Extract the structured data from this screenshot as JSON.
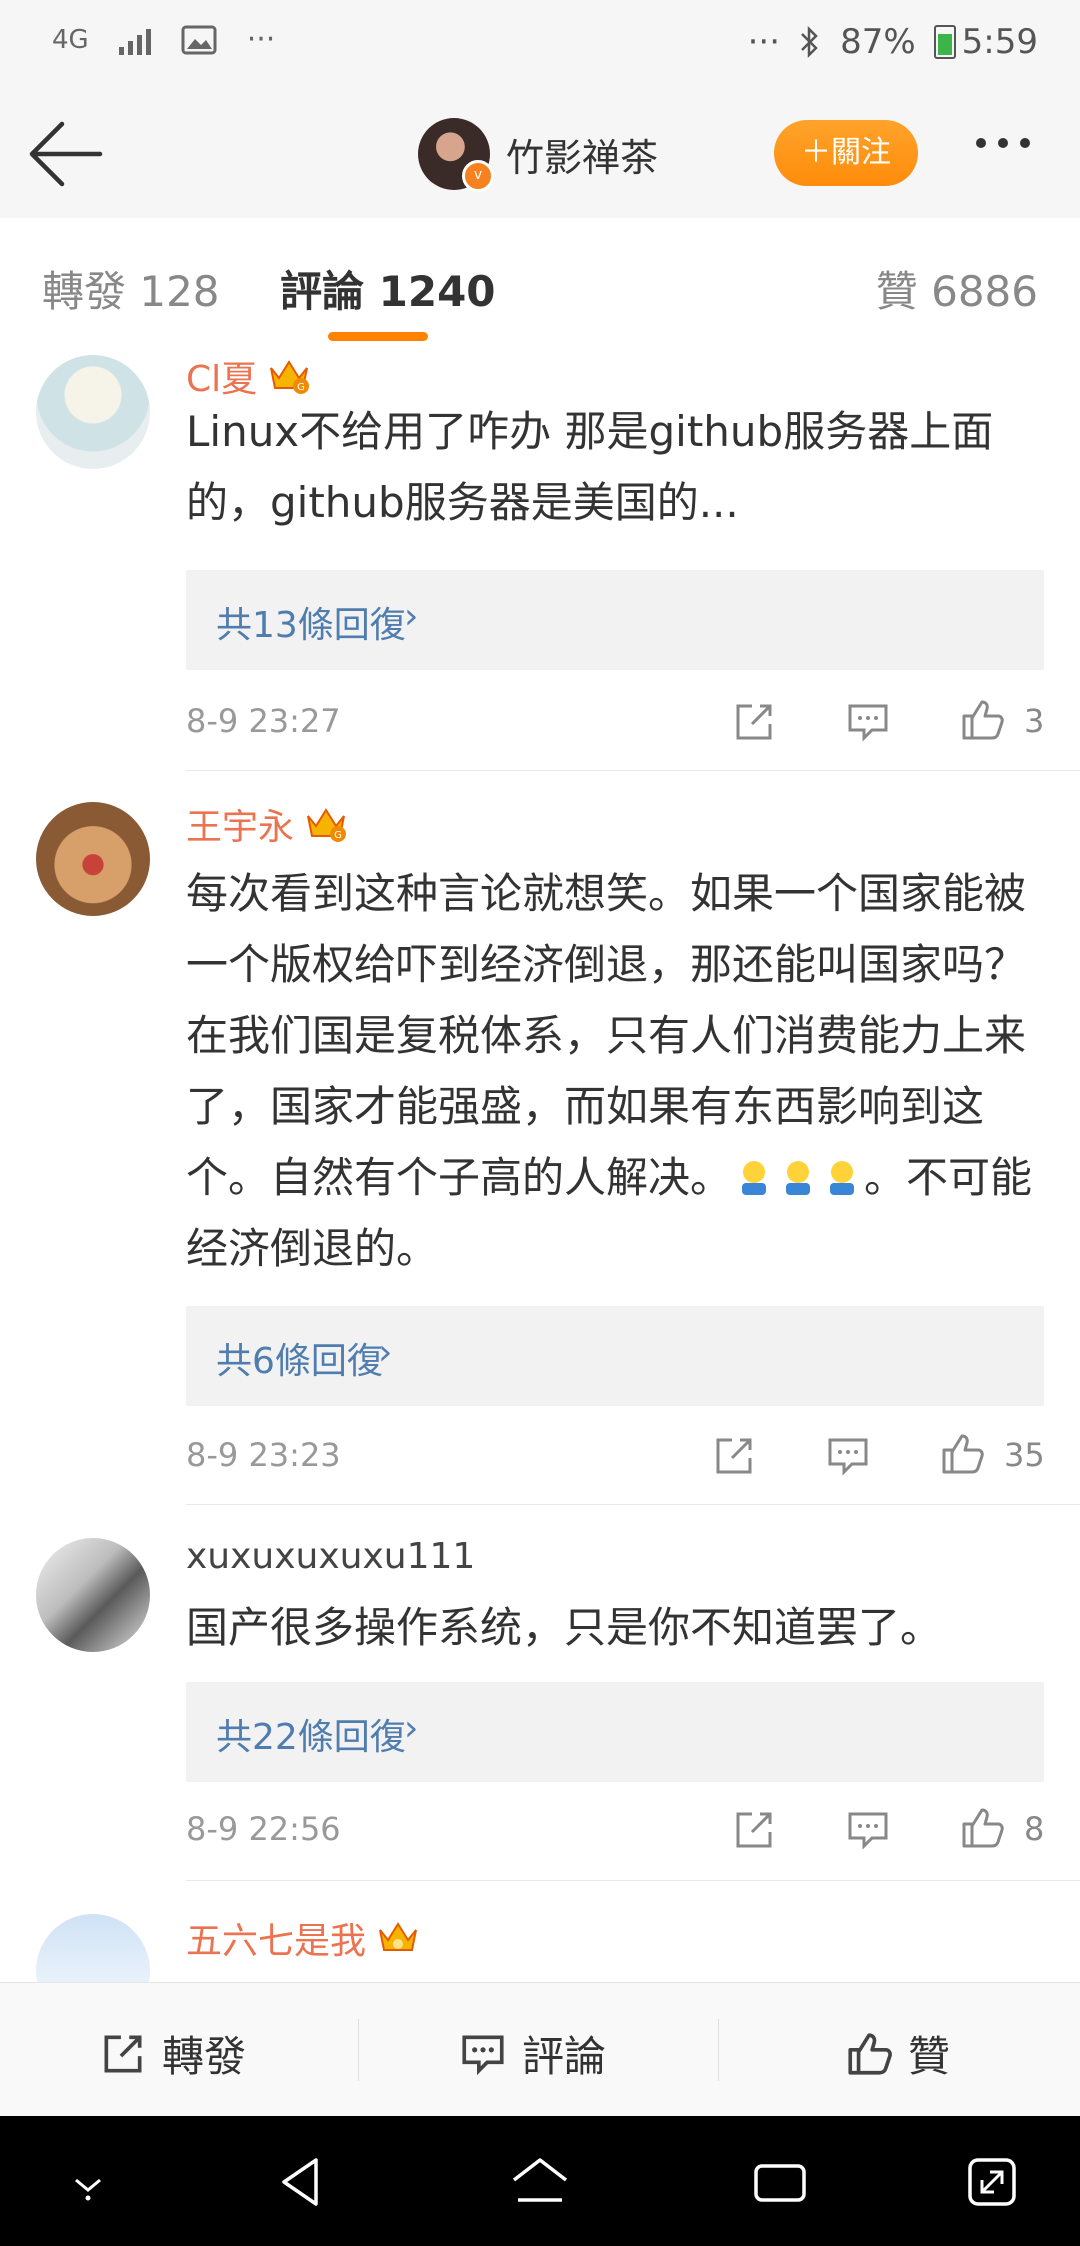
{
  "status_bar": {
    "network": "4G",
    "battery_percent": "87%",
    "time": "5:59",
    "more_left": "···",
    "more_right": "···"
  },
  "header": {
    "title": "竹影禅茶",
    "follow_label": "＋關注"
  },
  "tabs": {
    "repost": "轉發 128",
    "comments": "評論 1240",
    "likes": "贊 6886"
  },
  "comments": [
    {
      "name": "Cl夏",
      "text": "Linux不给用了咋办 那是github服务器上面的，github服务器是美国的...",
      "replies": "共13條回復",
      "time": "8-9 23:27",
      "likes": "3"
    },
    {
      "name": "王宇永",
      "text_a": "每次看到这种言论就想笑。如果一个国家能被一个版权给吓到经济倒退，那还能叫国家吗？在我们国是复税体系，只有人们消费能力上来了，国家才能强盛，而如果有东西影响到这个。自然有个子高的人解决。",
      "text_b": "。不可能经济倒退的。",
      "replies": "共6條回復",
      "time": "8-9 23:23",
      "likes": "35"
    },
    {
      "name": "xuxuxuxuxu111",
      "text": "国产很多操作系统，只是你不知道罢了。",
      "replies": "共22條回復",
      "time": "8-9 22:56",
      "likes": "8"
    },
    {
      "name": "五六七是我"
    }
  ],
  "bottom_bar": {
    "repost": "轉發",
    "comment": "評論",
    "like": "贊"
  },
  "colors": {
    "accent": "#ff8200",
    "username": "#eb7350",
    "link": "#507daf"
  }
}
